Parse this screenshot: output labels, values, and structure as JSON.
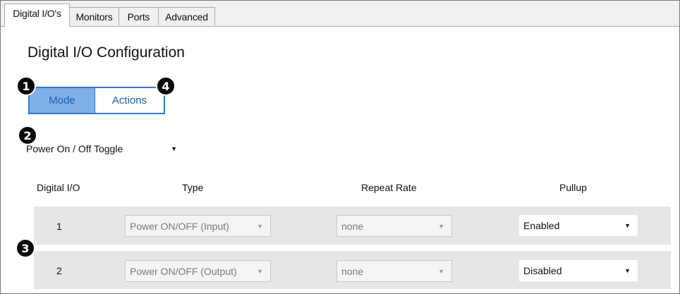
{
  "tabs": [
    "Digital I/O's",
    "Monitors",
    "Ports",
    "Advanced"
  ],
  "title": "Digital I/O Configuration",
  "toggle": {
    "mode": "Mode",
    "actions": "Actions"
  },
  "callouts": [
    "1",
    "2",
    "3",
    "4"
  ],
  "preset": {
    "value": "Power On / Off Toggle"
  },
  "columns": [
    "Digital I/O",
    "Type",
    "Repeat Rate",
    "Pullup"
  ],
  "rows": [
    {
      "num": "1",
      "type": "Power ON/OFF (Input)",
      "repeat": "none",
      "pullup": "Enabled"
    },
    {
      "num": "2",
      "type": "Power ON/OFF (Output)",
      "repeat": "none",
      "pullup": "Disabled"
    }
  ],
  "icons": {
    "dropdown": "chevron-down-icon"
  }
}
